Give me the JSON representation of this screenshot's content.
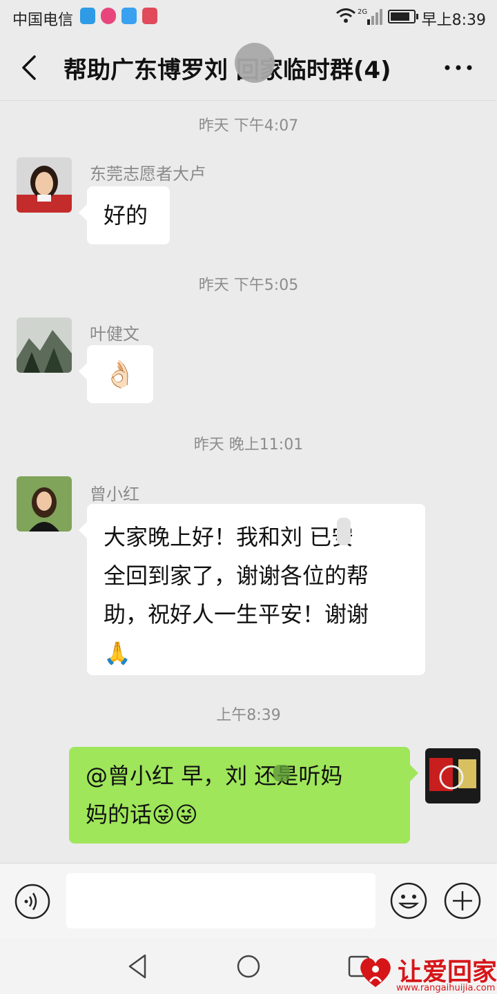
{
  "status_bar": {
    "carrier": "中国电信",
    "network": "2G",
    "time": "早上8:39",
    "battery_level": 0.85
  },
  "header": {
    "title": "帮助广东博罗刘 回家临时群(4)",
    "back_icon": "chevron-left-icon",
    "more_icon": "more-dots-icon"
  },
  "messages": [
    {
      "type": "time",
      "text": "昨天 下午4:07"
    },
    {
      "type": "incoming",
      "sender": "东莞志愿者大卢",
      "text": "好的"
    },
    {
      "type": "time",
      "text": "昨天 下午5:05"
    },
    {
      "type": "incoming",
      "sender": "叶健文",
      "text": "👌🏻"
    },
    {
      "type": "time",
      "text": "昨天 晚上11:01"
    },
    {
      "type": "incoming",
      "sender": "曾小红",
      "lines": [
        "大家晚上好！我和刘 已安",
        "全回到家了，谢谢各位的帮",
        "助，祝好人一生平安！谢谢",
        "🙏"
      ]
    },
    {
      "type": "time",
      "text": "上午8:39"
    },
    {
      "type": "outgoing",
      "lines": [
        "@曾小红  早，刘 还是听妈",
        "妈的话😜😜"
      ]
    }
  ],
  "input_bar": {
    "voice_icon": "voice-icon",
    "text_value": "",
    "emoji_icon": "emoji-icon",
    "plus_icon": "plus-icon"
  },
  "system_nav": {
    "back_icon": "nav-back-triangle-icon",
    "home_icon": "nav-home-circle-icon",
    "recent_icon": "nav-recent-square-icon"
  },
  "watermark": {
    "text": "让爱回家",
    "url": "www.rangaihuijia.com",
    "color": "#d61519"
  },
  "colors": {
    "background": "#ebebeb",
    "bubble_incoming": "#ffffff",
    "bubble_outgoing": "#9fe65a"
  }
}
